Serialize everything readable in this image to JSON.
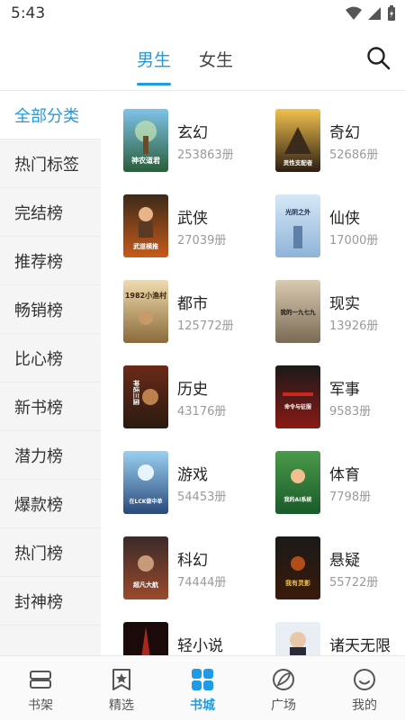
{
  "status": {
    "time": "5:43"
  },
  "header": {
    "tabs": [
      {
        "label": "男生",
        "active": true
      },
      {
        "label": "女生",
        "active": false
      }
    ]
  },
  "sidebar": {
    "items": [
      {
        "label": "全部分类",
        "active": true
      },
      {
        "label": "热门标签"
      },
      {
        "label": "完结榜"
      },
      {
        "label": "推荐榜"
      },
      {
        "label": "畅销榜"
      },
      {
        "label": "比心榜"
      },
      {
        "label": "新书榜"
      },
      {
        "label": "潜力榜"
      },
      {
        "label": "爆款榜"
      },
      {
        "label": "热门榜"
      },
      {
        "label": "封神榜"
      }
    ]
  },
  "categories": [
    {
      "name": "玄幻",
      "count": "253863册",
      "cover_text": "神农道君"
    },
    {
      "name": "奇幻",
      "count": "52686册",
      "cover_text": "灵性支配者"
    },
    {
      "name": "武侠",
      "count": "27039册",
      "cover_text": "武道横推"
    },
    {
      "name": "仙侠",
      "count": "17000册",
      "cover_text": "光阴之外"
    },
    {
      "name": "都市",
      "count": "125772册",
      "cover_text": "1982小渔村"
    },
    {
      "name": "现实",
      "count": "13926册",
      "cover_text": "我的一九七九"
    },
    {
      "name": "历史",
      "count": "43176册",
      "cover_text": "神话三国"
    },
    {
      "name": "军事",
      "count": "9583册",
      "cover_text": "命令与征服"
    },
    {
      "name": "游戏",
      "count": "54453册",
      "cover_text": "在LCK做中单"
    },
    {
      "name": "体育",
      "count": "7798册",
      "cover_text": "我的AI系统"
    },
    {
      "name": "科幻",
      "count": "74444册",
      "cover_text": "超凡大航"
    },
    {
      "name": "悬疑",
      "count": "55722册",
      "cover_text": "我有灵影"
    },
    {
      "name": "轻小说",
      "count": ""
    },
    {
      "name": "诸天无限",
      "count": ""
    }
  ],
  "bottom_nav": [
    {
      "label": "书架",
      "icon": "bookshelf-icon"
    },
    {
      "label": "精选",
      "icon": "star-badge-icon"
    },
    {
      "label": "书城",
      "icon": "grid-icon",
      "active": true
    },
    {
      "label": "广场",
      "icon": "leaf-icon"
    },
    {
      "label": "我的",
      "icon": "smile-icon"
    }
  ],
  "colors": {
    "accent": "#1e9be4",
    "sidebar_bg": "#f5f5f5"
  }
}
